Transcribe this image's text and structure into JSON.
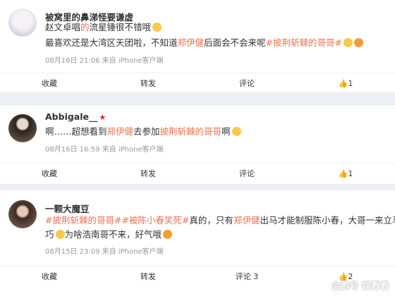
{
  "comments": [
    {
      "username": "被窝里的鼻涕怪要谦虚",
      "line1": [
        {
          "t": "赵文卓唱",
          "hl": false
        },
        {
          "t": "的",
          "hl": true
        },
        {
          "t": "流星锤很不错哦",
          "hl": false
        }
      ],
      "line2": [
        {
          "t": "最喜欢还是大湾区天团啦，不知道",
          "hl": false
        },
        {
          "t": "郑伊健",
          "hl": true
        },
        {
          "t": "后面会不会来呢",
          "hl": false
        },
        {
          "t": "#披荆斩棘的哥哥#",
          "hl": true
        }
      ],
      "meta": "08月16日 21:06  来自 iPhone客户端",
      "actions": {
        "collect": "收藏",
        "share": "转发",
        "comment": "评论",
        "like": "1"
      }
    },
    {
      "username": "Abbigale__",
      "line1": [
        {
          "t": "啊……超想看到",
          "hl": false
        },
        {
          "t": "郑伊健",
          "hl": true
        },
        {
          "t": "去参加",
          "hl": false
        },
        {
          "t": "披荆斩棘的哥哥",
          "hl": true
        },
        {
          "t": "啊",
          "hl": false
        }
      ],
      "meta": "08月16日 16:59  来自 iPhone客户端",
      "actions": {
        "collect": "收藏",
        "share": "转发",
        "comment": "评论",
        "like": "1"
      }
    },
    {
      "username": "一颗大魔豆",
      "line1": [
        {
          "t": "#披荆斩棘的哥哥##被陈小春笑死#",
          "hl": true
        },
        {
          "t": "真的",
          "hl": false
        },
        {
          "t": "，只有",
          "hl": false
        },
        {
          "t": "郑伊健",
          "hl": true
        },
        {
          "t": "出马才能制服陈小春，大哥一来立马乖",
          "hl": false
        }
      ],
      "line2": [
        {
          "t": "巧",
          "hl": false
        },
        {
          "t": "为啥浩南哥不来，好气哦",
          "hl": false
        }
      ],
      "meta": "08月15日 23:09  来自 iPhone客户端",
      "actions": {
        "collect": "收藏",
        "share": "转发",
        "comment": "评论 3",
        "like": "2"
      }
    }
  ],
  "watermark": "企鹅号 娱看看",
  "colors": {
    "highlight": "#eb7350",
    "background": "#eceff3",
    "meta": "#999999"
  }
}
